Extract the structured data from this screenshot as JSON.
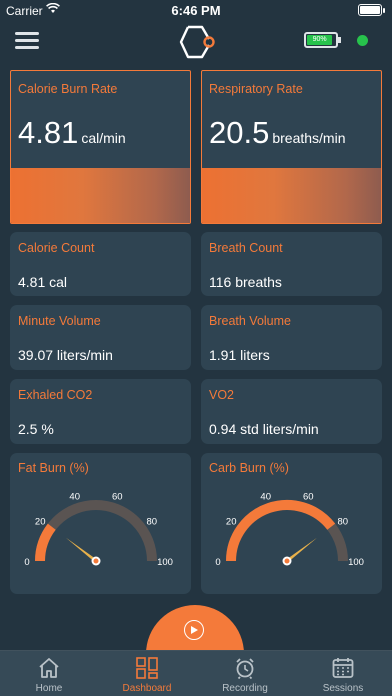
{
  "status_bar": {
    "carrier": "Carrier",
    "time": "6:46 PM"
  },
  "header": {
    "device_battery": "90%",
    "device_battery_level": 0.9,
    "connection_color": "#27c24c"
  },
  "accent_color": "#f47a3a",
  "metrics": {
    "calorie_burn_rate": {
      "title": "Calorie Burn Rate",
      "value": "4.81",
      "unit": "cal/min"
    },
    "respiratory_rate": {
      "title": "Respiratory Rate",
      "value": "20.5",
      "unit": "breaths/min"
    },
    "calorie_count": {
      "title": "Calorie Count",
      "value": "4.81 cal"
    },
    "breath_count": {
      "title": "Breath Count",
      "value": "116 breaths"
    },
    "minute_volume": {
      "title": "Minute Volume",
      "value": "39.07 liters/min"
    },
    "breath_volume": {
      "title": "Breath Volume",
      "value": "1.91 liters"
    },
    "exhaled_co2": {
      "title": "Exhaled CO2",
      "value": "2.5 %"
    },
    "vo2": {
      "title": "VO2",
      "value": "0.94 std liters/min"
    }
  },
  "gauges": {
    "fat_burn": {
      "title": "Fat Burn (%)",
      "value": 21,
      "ticks": [
        "0",
        "20",
        "40",
        "60",
        "80",
        "100"
      ]
    },
    "carb_burn": {
      "title": "Carb Burn (%)",
      "value": 79,
      "ticks": [
        "0",
        "20",
        "40",
        "60",
        "80",
        "100"
      ]
    }
  },
  "tabs": [
    {
      "label": "Home",
      "icon": "home-icon"
    },
    {
      "label": "Dashboard",
      "icon": "dashboard-icon"
    },
    {
      "label": "Recording",
      "icon": "alarm-clock-icon"
    },
    {
      "label": "Sessions",
      "icon": "calendar-icon"
    }
  ],
  "active_tab": "Dashboard"
}
